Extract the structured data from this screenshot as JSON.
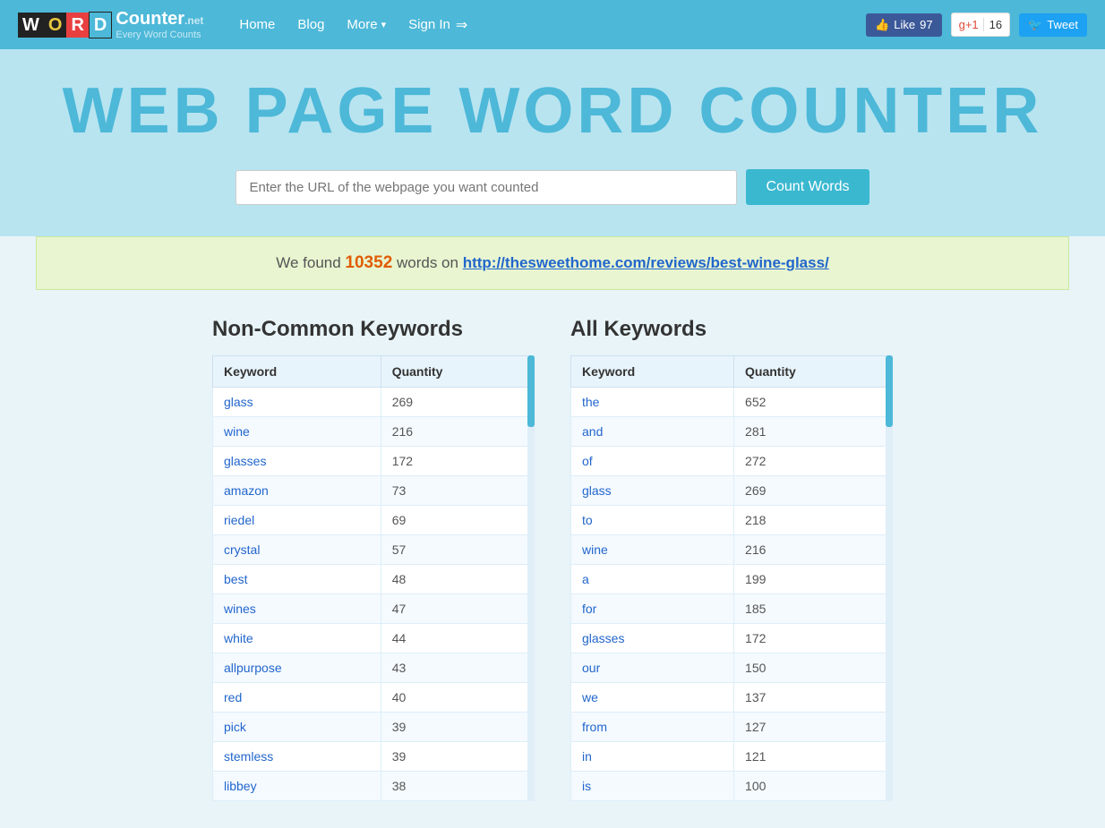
{
  "navbar": {
    "logo_letters": [
      "W",
      "O",
      "R",
      "D"
    ],
    "logo_name": "Counter",
    "logo_net": ".net",
    "logo_tagline": "Every Word Counts",
    "nav_home": "Home",
    "nav_blog": "Blog",
    "nav_more": "More",
    "nav_more_arrow": "▾",
    "nav_signin": "Sign In",
    "nav_signin_icon": "→",
    "fb_like": "Like",
    "fb_count": "97",
    "gplus_label": "g+1",
    "gplus_count": "16",
    "tweet": "Tweet"
  },
  "hero": {
    "title": "WEB PAGE WORD COUNTER",
    "url_placeholder": "Enter the URL of the webpage you want counted",
    "count_button": "Count Words"
  },
  "result": {
    "prefix": "We found ",
    "count": "10352",
    "middle": " words on ",
    "url": "http://thesweethome.com/reviews/best-wine-glass/"
  },
  "non_common": {
    "title": "Non-Common Keywords",
    "col_keyword": "Keyword",
    "col_quantity": "Quantity",
    "rows": [
      {
        "keyword": "glass",
        "quantity": "269"
      },
      {
        "keyword": "wine",
        "quantity": "216"
      },
      {
        "keyword": "glasses",
        "quantity": "172"
      },
      {
        "keyword": "amazon",
        "quantity": "73"
      },
      {
        "keyword": "riedel",
        "quantity": "69"
      },
      {
        "keyword": "crystal",
        "quantity": "57"
      },
      {
        "keyword": "best",
        "quantity": "48"
      },
      {
        "keyword": "wines",
        "quantity": "47"
      },
      {
        "keyword": "white",
        "quantity": "44"
      },
      {
        "keyword": "allpurpose",
        "quantity": "43"
      },
      {
        "keyword": "red",
        "quantity": "40"
      },
      {
        "keyword": "pick",
        "quantity": "39"
      },
      {
        "keyword": "stemless",
        "quantity": "39"
      },
      {
        "keyword": "libbey",
        "quantity": "38"
      }
    ]
  },
  "all_keywords": {
    "title": "All Keywords",
    "col_keyword": "Keyword",
    "col_quantity": "Quantity",
    "rows": [
      {
        "keyword": "the",
        "quantity": "652"
      },
      {
        "keyword": "and",
        "quantity": "281"
      },
      {
        "keyword": "of",
        "quantity": "272"
      },
      {
        "keyword": "glass",
        "quantity": "269"
      },
      {
        "keyword": "to",
        "quantity": "218"
      },
      {
        "keyword": "wine",
        "quantity": "216"
      },
      {
        "keyword": "a",
        "quantity": "199"
      },
      {
        "keyword": "for",
        "quantity": "185"
      },
      {
        "keyword": "glasses",
        "quantity": "172"
      },
      {
        "keyword": "our",
        "quantity": "150"
      },
      {
        "keyword": "we",
        "quantity": "137"
      },
      {
        "keyword": "from",
        "quantity": "127"
      },
      {
        "keyword": "in",
        "quantity": "121"
      },
      {
        "keyword": "is",
        "quantity": "100"
      }
    ]
  }
}
